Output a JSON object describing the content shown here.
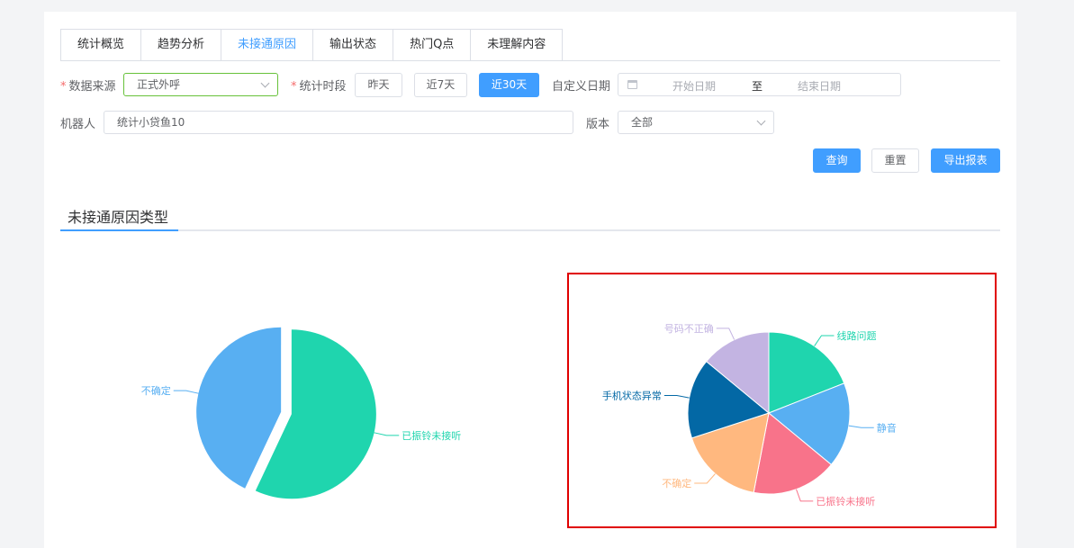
{
  "tabs": [
    "统计概览",
    "趋势分析",
    "未接通原因",
    "输出状态",
    "热门Q点",
    "未理解内容"
  ],
  "active_tab": "未接通原因",
  "filters": {
    "source_label": "数据来源",
    "source_value": "正式外呼",
    "period_label": "统计时段",
    "period_buttons": [
      "昨天",
      "近7天",
      "近30天"
    ],
    "period_active": "近30天",
    "custom_date_label": "自定义日期",
    "start_placeholder": "开始日期",
    "date_separator": "至",
    "end_placeholder": "结束日期",
    "robot_label": "机器人",
    "robot_value": "统计小贷鱼10",
    "version_label": "版本",
    "version_value": "全部"
  },
  "actions": {
    "query": "查询",
    "reset": "重置",
    "export": "导出报表"
  },
  "section_title": "未接通原因类型",
  "colors": {
    "primary": "#409eff",
    "teal": "#1fd5ae",
    "blue": "#58aff2",
    "pink": "#f8738a",
    "orange": "#ffb87f",
    "navy": "#0368a5",
    "lavender": "#c3b4e2",
    "highlight": "#e00000"
  },
  "chart_data": [
    {
      "type": "pie",
      "labels": [
        "已振铃未接听",
        "不确定"
      ],
      "values": [
        57,
        43
      ],
      "colors": [
        "#1fd5ae",
        "#58aff2"
      ]
    },
    {
      "type": "pie",
      "labels": [
        "线路问题",
        "静音",
        "已振铃未接听",
        "不确定",
        "手机状态异常",
        "号码不正确"
      ],
      "values": [
        19,
        17,
        17,
        17,
        16,
        14
      ],
      "colors": [
        "#1fd5ae",
        "#58aff2",
        "#f8738a",
        "#ffb87f",
        "#0368a5",
        "#c3b4e2"
      ]
    }
  ]
}
